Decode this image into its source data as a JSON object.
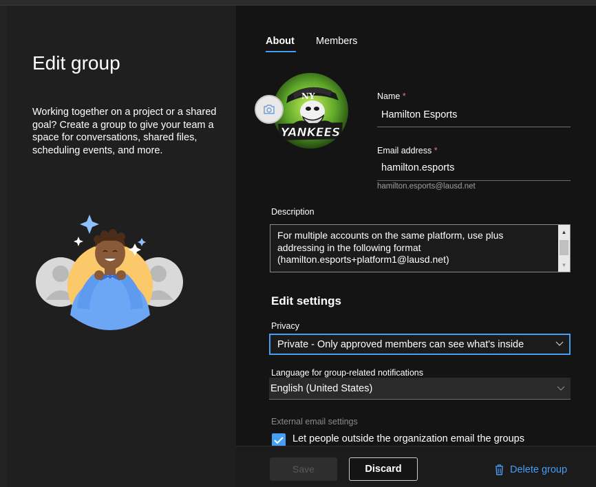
{
  "left": {
    "title": "Edit group",
    "description": "Working together on a project or a shared goal? Create a group to give your team a space for conversations, shared files, scheduling events, and more."
  },
  "tabs": [
    {
      "label": "About",
      "active": true
    },
    {
      "label": "Members",
      "active": false
    }
  ],
  "avatar": {
    "text": "YANKEES",
    "icon": "camera-icon"
  },
  "name_field": {
    "label": "Name",
    "required_marker": "*",
    "value": "Hamilton Esports"
  },
  "email_field": {
    "label": "Email address",
    "required_marker": "*",
    "value": "hamilton.esports",
    "helper": "hamilton.esports@lausd.net"
  },
  "description_field": {
    "label": "Description",
    "value": "For multiple accounts on the same platform, use plus addressing in the following format (hamilton.esports+platform1@lausd.net)"
  },
  "settings": {
    "title": "Edit settings",
    "privacy_label": "Privacy",
    "privacy_value": "Private - Only approved members can see what's inside",
    "language_label": "Language for group-related notifications",
    "language_value": "English (United States)",
    "external_label": "External email settings",
    "external_checkbox_label": "Let people outside the organization email the groups",
    "external_checked": true
  },
  "footer": {
    "save_label": "Save",
    "discard_label": "Discard",
    "delete_label": "Delete group"
  },
  "colors": {
    "accent": "#479ef5",
    "required": "#e37d80"
  }
}
